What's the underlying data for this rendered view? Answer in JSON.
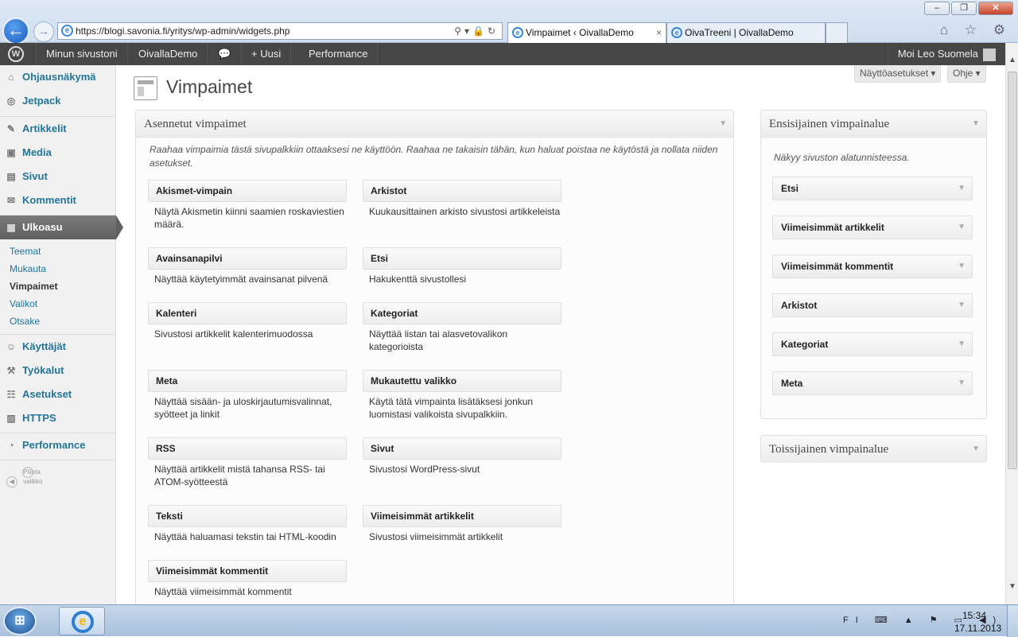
{
  "browser": {
    "url": "https://blogi.savonia.fi/yritys/wp-admin/widgets.php",
    "tabs": [
      {
        "label": "Vimpaimet ‹ OivallaDemo",
        "close": "×"
      },
      {
        "label": "OivaTreeni | OivallaDemo"
      }
    ],
    "window_controls": [
      "–",
      "❐",
      "✕"
    ],
    "toolbar_icons": "⌂ ☆ ⚙",
    "address_tools": "⚲▾🔒↻"
  },
  "adminbar": {
    "site": "Minun sivustoni",
    "blog": "OivallaDemo",
    "comments_icon": "speech-bubble-icon",
    "new": "+ Uusi",
    "performance": "Performance",
    "user": "Moi Leo Suomela"
  },
  "menu": {
    "items": [
      {
        "label": "Ohjausnäkymä",
        "icon": "⌂"
      },
      {
        "label": "Jetpack",
        "icon": "◎"
      },
      {
        "label": "Artikkelit",
        "icon": "✎"
      },
      {
        "label": "Media",
        "icon": "▣"
      },
      {
        "label": "Sivut",
        "icon": "▤"
      },
      {
        "label": "Kommentit",
        "icon": "✉"
      },
      {
        "label": "Ulkoasu",
        "icon": "▦"
      },
      {
        "label": "Käyttäjät",
        "icon": "☺"
      },
      {
        "label": "Työkalut",
        "icon": "⚒"
      },
      {
        "label": "Asetukset",
        "icon": "☷"
      },
      {
        "label": "HTTPS",
        "icon": "▥"
      },
      {
        "label": "Performance",
        "icon": "◔"
      }
    ],
    "sub": [
      "Teemat",
      "Mukauta",
      "Vimpaimet",
      "Valikot",
      "Otsake"
    ],
    "collapse": "Piilota valikko"
  },
  "screen_options": "Näyttöasetukset ▾",
  "help": "Ohje ▾",
  "page_title": "Vimpaimet",
  "available": {
    "title": "Asennetut vimpaimet",
    "description": "Raahaa vimpaimia tästä sivupalkkiin ottaaksesi ne käyttöön. Raahaa ne takaisin tähän, kun haluat poistaa ne käytöstä ja nollata niiden asetukset.",
    "widgets": [
      {
        "name": "Akismet-vimpain",
        "desc": "Näytä Akismetin kiinni saamien roskaviestien määrä."
      },
      {
        "name": "Arkistot",
        "desc": "Kuukausittainen arkisto sivustosi artikkeleista"
      },
      {
        "name": "Avainsanapilvi",
        "desc": "Näyttää käytetyimmät avainsanat pilvenä"
      },
      {
        "name": "Etsi",
        "desc": "Hakukenttä sivustollesi"
      },
      {
        "name": "Kalenteri",
        "desc": "Sivustosi artikkelit kalenterimuodossa"
      },
      {
        "name": "Kategoriat",
        "desc": "Näyttää listan tai alasvetovalikon kategorioista"
      },
      {
        "name": "Meta",
        "desc": "Näyttää sisään- ja uloskirjautumisvalinnat, syötteet ja linkit"
      },
      {
        "name": "Mukautettu valikko",
        "desc": "Käytä tätä vimpainta lisätäksesi jonkun luomistasi valikoista sivupalkkiin."
      },
      {
        "name": "RSS",
        "desc": "Näyttää artikkelit mistä tahansa RSS- tai ATOM-syötteestä"
      },
      {
        "name": "Sivut",
        "desc": "Sivustosi WordPress-sivut"
      },
      {
        "name": "Teksti",
        "desc": "Näyttää haluamasi tekstin tai HTML-koodin"
      },
      {
        "name": "Viimeisimmät artikkelit",
        "desc": "Sivustosi viimeisimmät artikkelit"
      },
      {
        "name": "Viimeisimmät kommentit",
        "desc": "Näyttää viimeisimmät kommentit"
      }
    ]
  },
  "primary": {
    "title": "Ensisijainen vimpainalue",
    "description": "Näkyy sivuston alatunnisteessa.",
    "widgets": [
      "Etsi",
      "Viimeisimmät artikkelit",
      "Viimeisimmät kommentit",
      "Arkistot",
      "Kategoriat",
      "Meta"
    ]
  },
  "secondary": {
    "title": "Toissijainen vimpainalue"
  },
  "arrow": "▼",
  "taskbar": {
    "lang": "FI",
    "tray_icons": "⌨ ▲ ⚑ ▭ ◀)",
    "time": "15:34",
    "date": "17.11.2013"
  }
}
